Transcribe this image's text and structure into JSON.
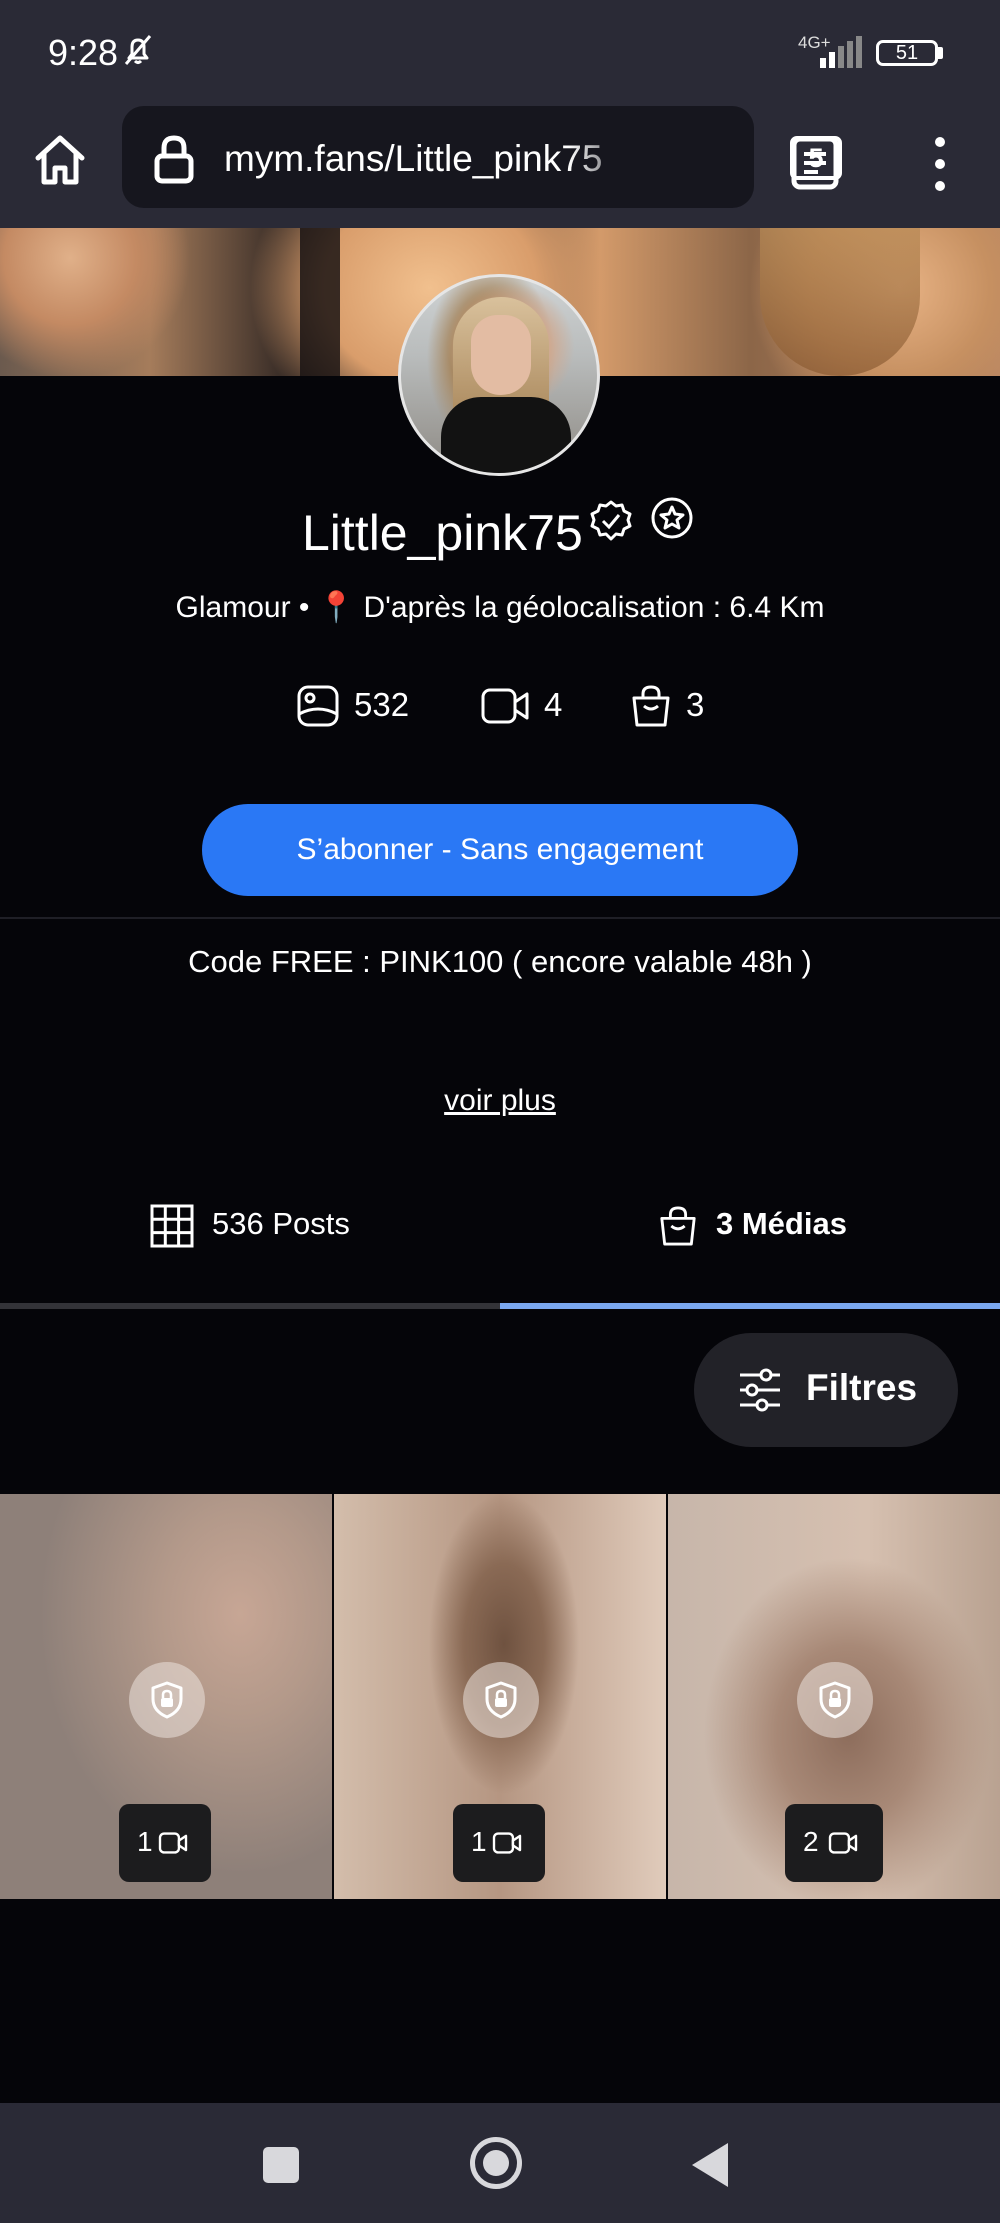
{
  "status_bar": {
    "time": "9:28",
    "network": "4G+",
    "battery": "51"
  },
  "browser": {
    "url": "mym.fans/Little_pink75",
    "tab_count": "5"
  },
  "profile": {
    "username": "Little_pink75",
    "category": "Glamour",
    "separator": "•",
    "location_icon": "📍",
    "location": "D'après la géolocalisation : 6.4 Km",
    "stats": {
      "photos": "532",
      "videos": "4",
      "medias": "3"
    },
    "subscribe_label": "S’abonner - Sans engagement",
    "description": "Code FREE : PINK100 ( encore valable 48h )",
    "more_label": "voir plus"
  },
  "tabs": {
    "posts_label": "536 Posts",
    "medias_label": "3 Médias",
    "active": "medias"
  },
  "filter": {
    "label": "Filtres"
  },
  "media_tiles": [
    {
      "video_count": "1"
    },
    {
      "video_count": "1"
    },
    {
      "video_count": "2"
    }
  ],
  "colors": {
    "accent": "#2a78f5",
    "active_tab": "#7aa7ef",
    "background": "#050509",
    "bars": "#2a2a36"
  }
}
